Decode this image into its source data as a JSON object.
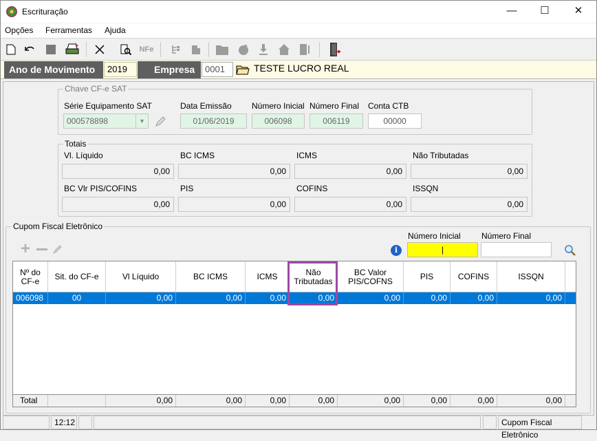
{
  "window": {
    "title": "Escrituração",
    "minimize": "—",
    "maximize": "☐",
    "close": "✕"
  },
  "menu": [
    "Opções",
    "Ferramentas",
    "Ajuda"
  ],
  "filter": {
    "ano_label": "Ano de Movimento",
    "ano_value": "2019",
    "empresa_label": "Empresa",
    "empresa_code": "0001",
    "empresa_name": "TESTE LUCRO REAL"
  },
  "chave": {
    "legend": "Chave CF-e SAT",
    "serie_label": "Série Equipamento SAT",
    "serie_value": "000578898",
    "data_label": "Data Emissão",
    "data_value": "01/06/2019",
    "num_ini_label": "Número Inicial",
    "num_ini_value": "006098",
    "num_fin_label": "Número Final",
    "num_fin_value": "006119",
    "conta_label": "Conta CTB",
    "conta_value": "00000"
  },
  "totais": {
    "legend": "Totais",
    "vl_liquido_label": "Vl. Líquido",
    "vl_liquido": "0,00",
    "bc_icms_label": "BC ICMS",
    "bc_icms": "0,00",
    "icms_label": "ICMS",
    "icms": "0,00",
    "nao_trib_label": "Não Tributadas",
    "nao_trib": "0,00",
    "bc_pis_label": "BC Vlr PIS/COFINS",
    "bc_pis": "0,00",
    "pis_label": "PIS",
    "pis": "0,00",
    "cofins_label": "COFINS",
    "cofins": "0,00",
    "issqn_label": "ISSQN",
    "issqn": "0,00"
  },
  "cupom": {
    "legend": "Cupom Fiscal Eletrônico",
    "num_ini_label": "Número Inicial",
    "num_ini_value": "|",
    "num_fin_label": "Número Final",
    "num_fin_value": ""
  },
  "table": {
    "headers": [
      "Nº do CF-e",
      "Sit. do CF-e",
      "Vl Líquido",
      "BC ICMS",
      "ICMS",
      "Não Tributadas",
      "BC Valor PIS/COFNS",
      "PIS",
      "COFINS",
      "ISSQN"
    ],
    "rows": [
      [
        "006098",
        "00",
        "0,00",
        "0,00",
        "0,00",
        "0,00",
        "0,00",
        "0,00",
        "0,00",
        "0,00"
      ]
    ],
    "footer": [
      "Total",
      "",
      "0,00",
      "0,00",
      "0,00",
      "0,00",
      "0,00",
      "0,00",
      "0,00",
      "0,00"
    ]
  },
  "status": {
    "time": "12:12",
    "module": "Cupom Fiscal Eletrônico"
  },
  "colors": {
    "selection": "#0078d7",
    "highlight_border": "#9b4aa6",
    "input_yellow": "#ffff00",
    "header_label_bg": "#5f5f5f"
  }
}
